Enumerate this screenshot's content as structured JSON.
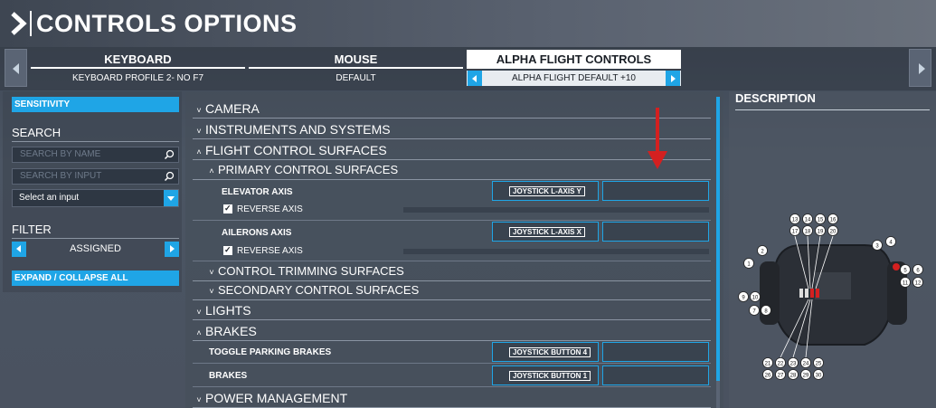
{
  "header": {
    "title": "CONTROLS OPTIONS"
  },
  "devices": [
    {
      "name": "KEYBOARD",
      "profile": "KEYBOARD PROFILE 2- NO F7"
    },
    {
      "name": "MOUSE",
      "profile": "DEFAULT"
    },
    {
      "name": "ALPHA FLIGHT CONTROLS",
      "profile": "ALPHA FLIGHT DEFAULT +10"
    }
  ],
  "sidebar": {
    "sensitivity_label": "SENSITIVITY",
    "search_title": "SEARCH",
    "search_by_name_placeholder": "SEARCH BY NAME",
    "search_by_input_placeholder": "SEARCH BY INPUT",
    "select_input_value": "Select an input",
    "filter_title": "FILTER",
    "filter_value": "ASSIGNED",
    "expand_collapse_label": "EXPAND / COLLAPSE ALL"
  },
  "list": {
    "categories": {
      "camera": "CAMERA",
      "instruments": "INSTRUMENTS AND SYSTEMS",
      "flight_surfaces": "FLIGHT CONTROL SURFACES",
      "primary": "PRIMARY CONTROL SURFACES",
      "trimming": "CONTROL TRIMMING SURFACES",
      "secondary": "SECONDARY CONTROL SURFACES",
      "lights": "LIGHTS",
      "brakes": "BRAKES",
      "power": "POWER MANAGEMENT"
    },
    "bindings": {
      "elevator": {
        "label": "ELEVATOR AXIS",
        "input": "JOYSTICK L-AXIS Y",
        "reverse": "REVERSE AXIS"
      },
      "ailerons": {
        "label": "AILERONS AXIS",
        "input": "JOYSTICK L-AXIS X",
        "reverse": "REVERSE AXIS"
      },
      "parking": {
        "label": "TOGGLE PARKING BRAKES",
        "input": "JOYSTICK BUTTON 4"
      },
      "brakes": {
        "label": "BRAKES",
        "input": "JOYSTICK BUTTON 1"
      }
    }
  },
  "description": {
    "title": "DESCRIPTION",
    "button_numbers": [
      "1",
      "2",
      "3",
      "4",
      "5",
      "6",
      "7",
      "8",
      "9",
      "10",
      "11",
      "12",
      "13",
      "14",
      "15",
      "16",
      "17",
      "18",
      "19",
      "20",
      "21",
      "22",
      "23",
      "24",
      "25",
      "26",
      "27",
      "28",
      "29",
      "30"
    ]
  },
  "colors": {
    "accent": "#1fa5e6",
    "annotation_arrow": "#d42020"
  }
}
